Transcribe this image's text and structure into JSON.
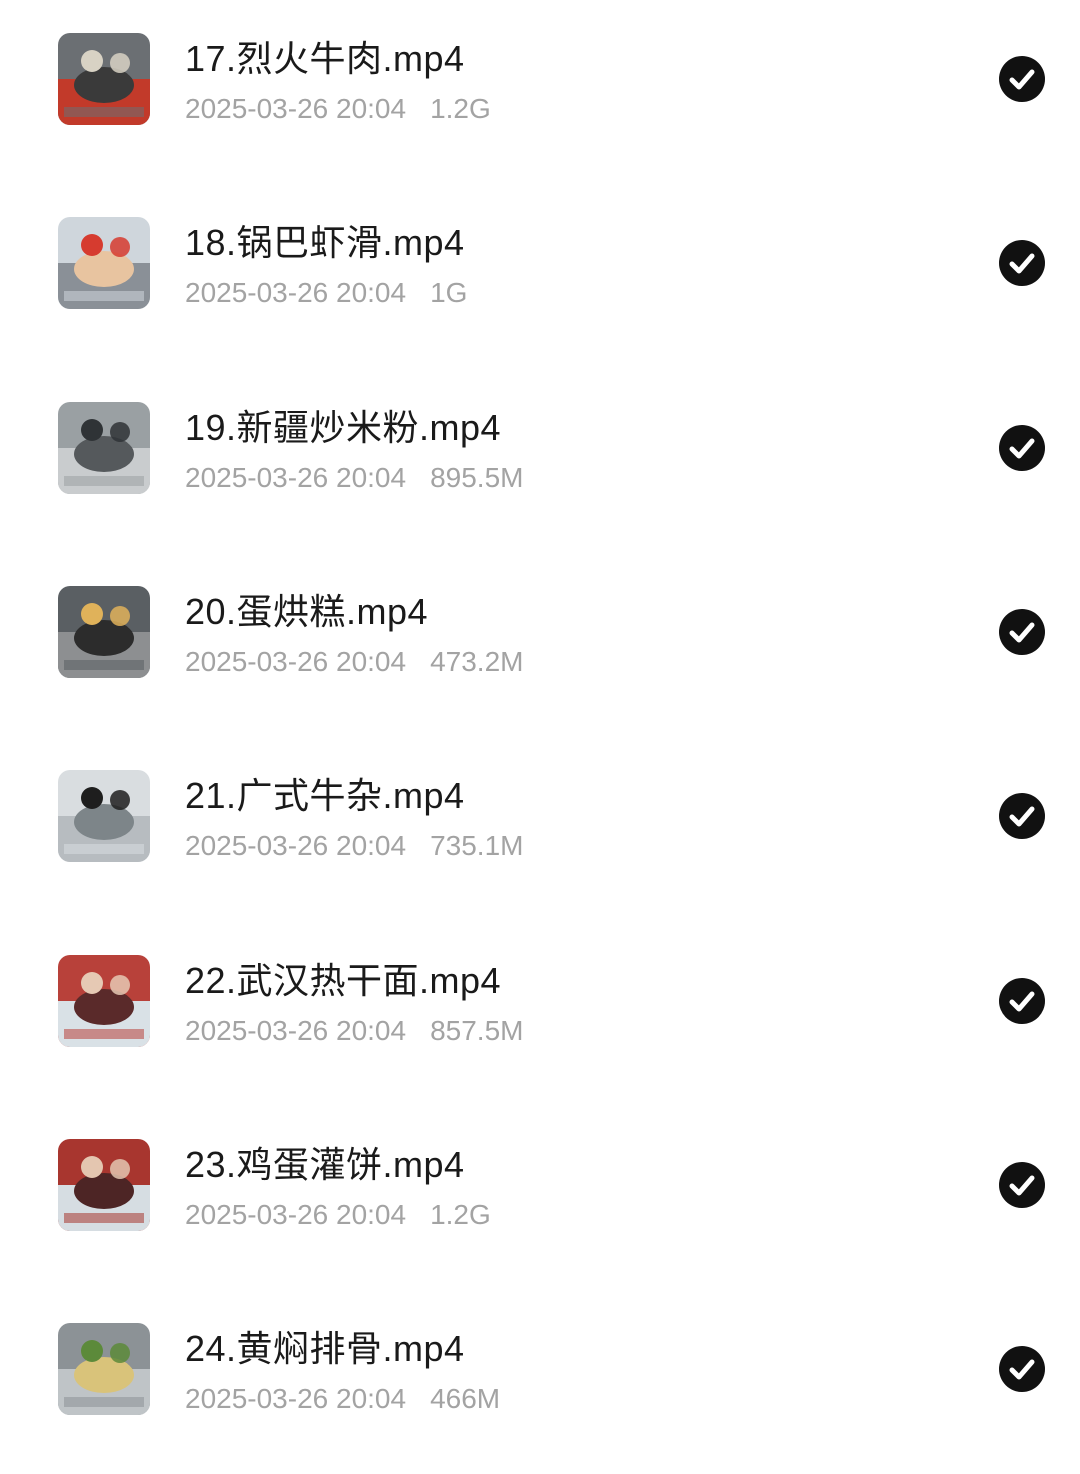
{
  "files": [
    {
      "name": "17.烈火牛肉.mp4",
      "date": "2025-03-26 20:04",
      "size": "1.2G",
      "thumb_colors": [
        "#6b6f73",
        "#d8d2c4",
        "#3a3a3a",
        "#c23a2a"
      ],
      "selected": true
    },
    {
      "name": "18.锅巴虾滑.mp4",
      "date": "2025-03-26 20:04",
      "size": "1G",
      "thumb_colors": [
        "#cfd6dc",
        "#d63b2f",
        "#e8c4a0",
        "#8a9097"
      ],
      "selected": true
    },
    {
      "name": "19.新疆炒米粉.mp4",
      "date": "2025-03-26 20:04",
      "size": "895.5M",
      "thumb_colors": [
        "#9aa0a3",
        "#2f3336",
        "#55595c",
        "#c9ccce"
      ],
      "selected": true
    },
    {
      "name": "20.蛋烘糕.mp4",
      "date": "2025-03-26 20:04",
      "size": "473.2M",
      "thumb_colors": [
        "#5a5f63",
        "#e0b25a",
        "#2c2c2c",
        "#8d8f91"
      ],
      "selected": true
    },
    {
      "name": "21.广式牛杂.mp4",
      "date": "2025-03-26 20:04",
      "size": "735.1M",
      "thumb_colors": [
        "#d9dde0",
        "#1e1e1e",
        "#7d8589",
        "#b7bcc0"
      ],
      "selected": true
    },
    {
      "name": "22.武汉热干面.mp4",
      "date": "2025-03-26 20:04",
      "size": "857.5M",
      "thumb_colors": [
        "#b8413a",
        "#e6c9b4",
        "#5a2a2a",
        "#d9e1e6"
      ],
      "selected": true
    },
    {
      "name": "23.鸡蛋灌饼.mp4",
      "date": "2025-03-26 20:04",
      "size": "1.2G",
      "thumb_colors": [
        "#a8362f",
        "#e4c6b0",
        "#4d2525",
        "#d6dde2"
      ],
      "selected": true
    },
    {
      "name": "24.黄焖排骨.mp4",
      "date": "2025-03-26 20:04",
      "size": "466M",
      "thumb_colors": [
        "#8c9296",
        "#5c8a3a",
        "#d9c37a",
        "#bfc4c7"
      ],
      "selected": true
    }
  ],
  "icons": {
    "thumbnail": "video-thumbnail",
    "selected": "check-circle-icon"
  },
  "colors": {
    "title": "#1a1a1a",
    "meta": "#a3a3a3",
    "check_bg": "#111111",
    "background": "#ffffff"
  }
}
